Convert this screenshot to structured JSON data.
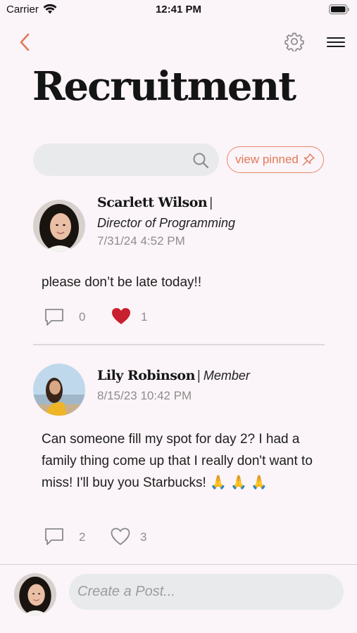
{
  "status_bar": {
    "carrier": "Carrier",
    "time": "12:41 PM"
  },
  "header": {
    "title": "Recruitment"
  },
  "search": {
    "placeholder": "",
    "pinned_label": "view pinned"
  },
  "colors": {
    "accent": "#e07a58",
    "heart_red": "#c8202e",
    "background": "#fbf4f8",
    "field_gray": "#e9eaeb"
  },
  "posts": [
    {
      "author": "Scarlett Wilson",
      "separator": "|",
      "role": "Director of Programming",
      "timestamp": "7/31/24 4:52 PM",
      "body": "please don’t be late today!!",
      "comments": "0",
      "likes": "1",
      "liked": true
    },
    {
      "author": "Lily Robinson",
      "separator": "|",
      "role": "Member",
      "timestamp": "8/15/23 10:42 PM",
      "body": "Can someone fill my spot for day 2? I had a family thing come up that I really don't want to miss! I'll buy you Starbucks! 🙏 🙏 🙏",
      "comments": "2",
      "likes": "3",
      "liked": false
    }
  ],
  "composer": {
    "placeholder": "Create a Post..."
  },
  "icons": [
    "back-icon",
    "gear-icon",
    "menu-icon",
    "search-icon",
    "pin-icon",
    "comment-icon",
    "heart-icon",
    "wifi-icon",
    "battery-icon"
  ]
}
